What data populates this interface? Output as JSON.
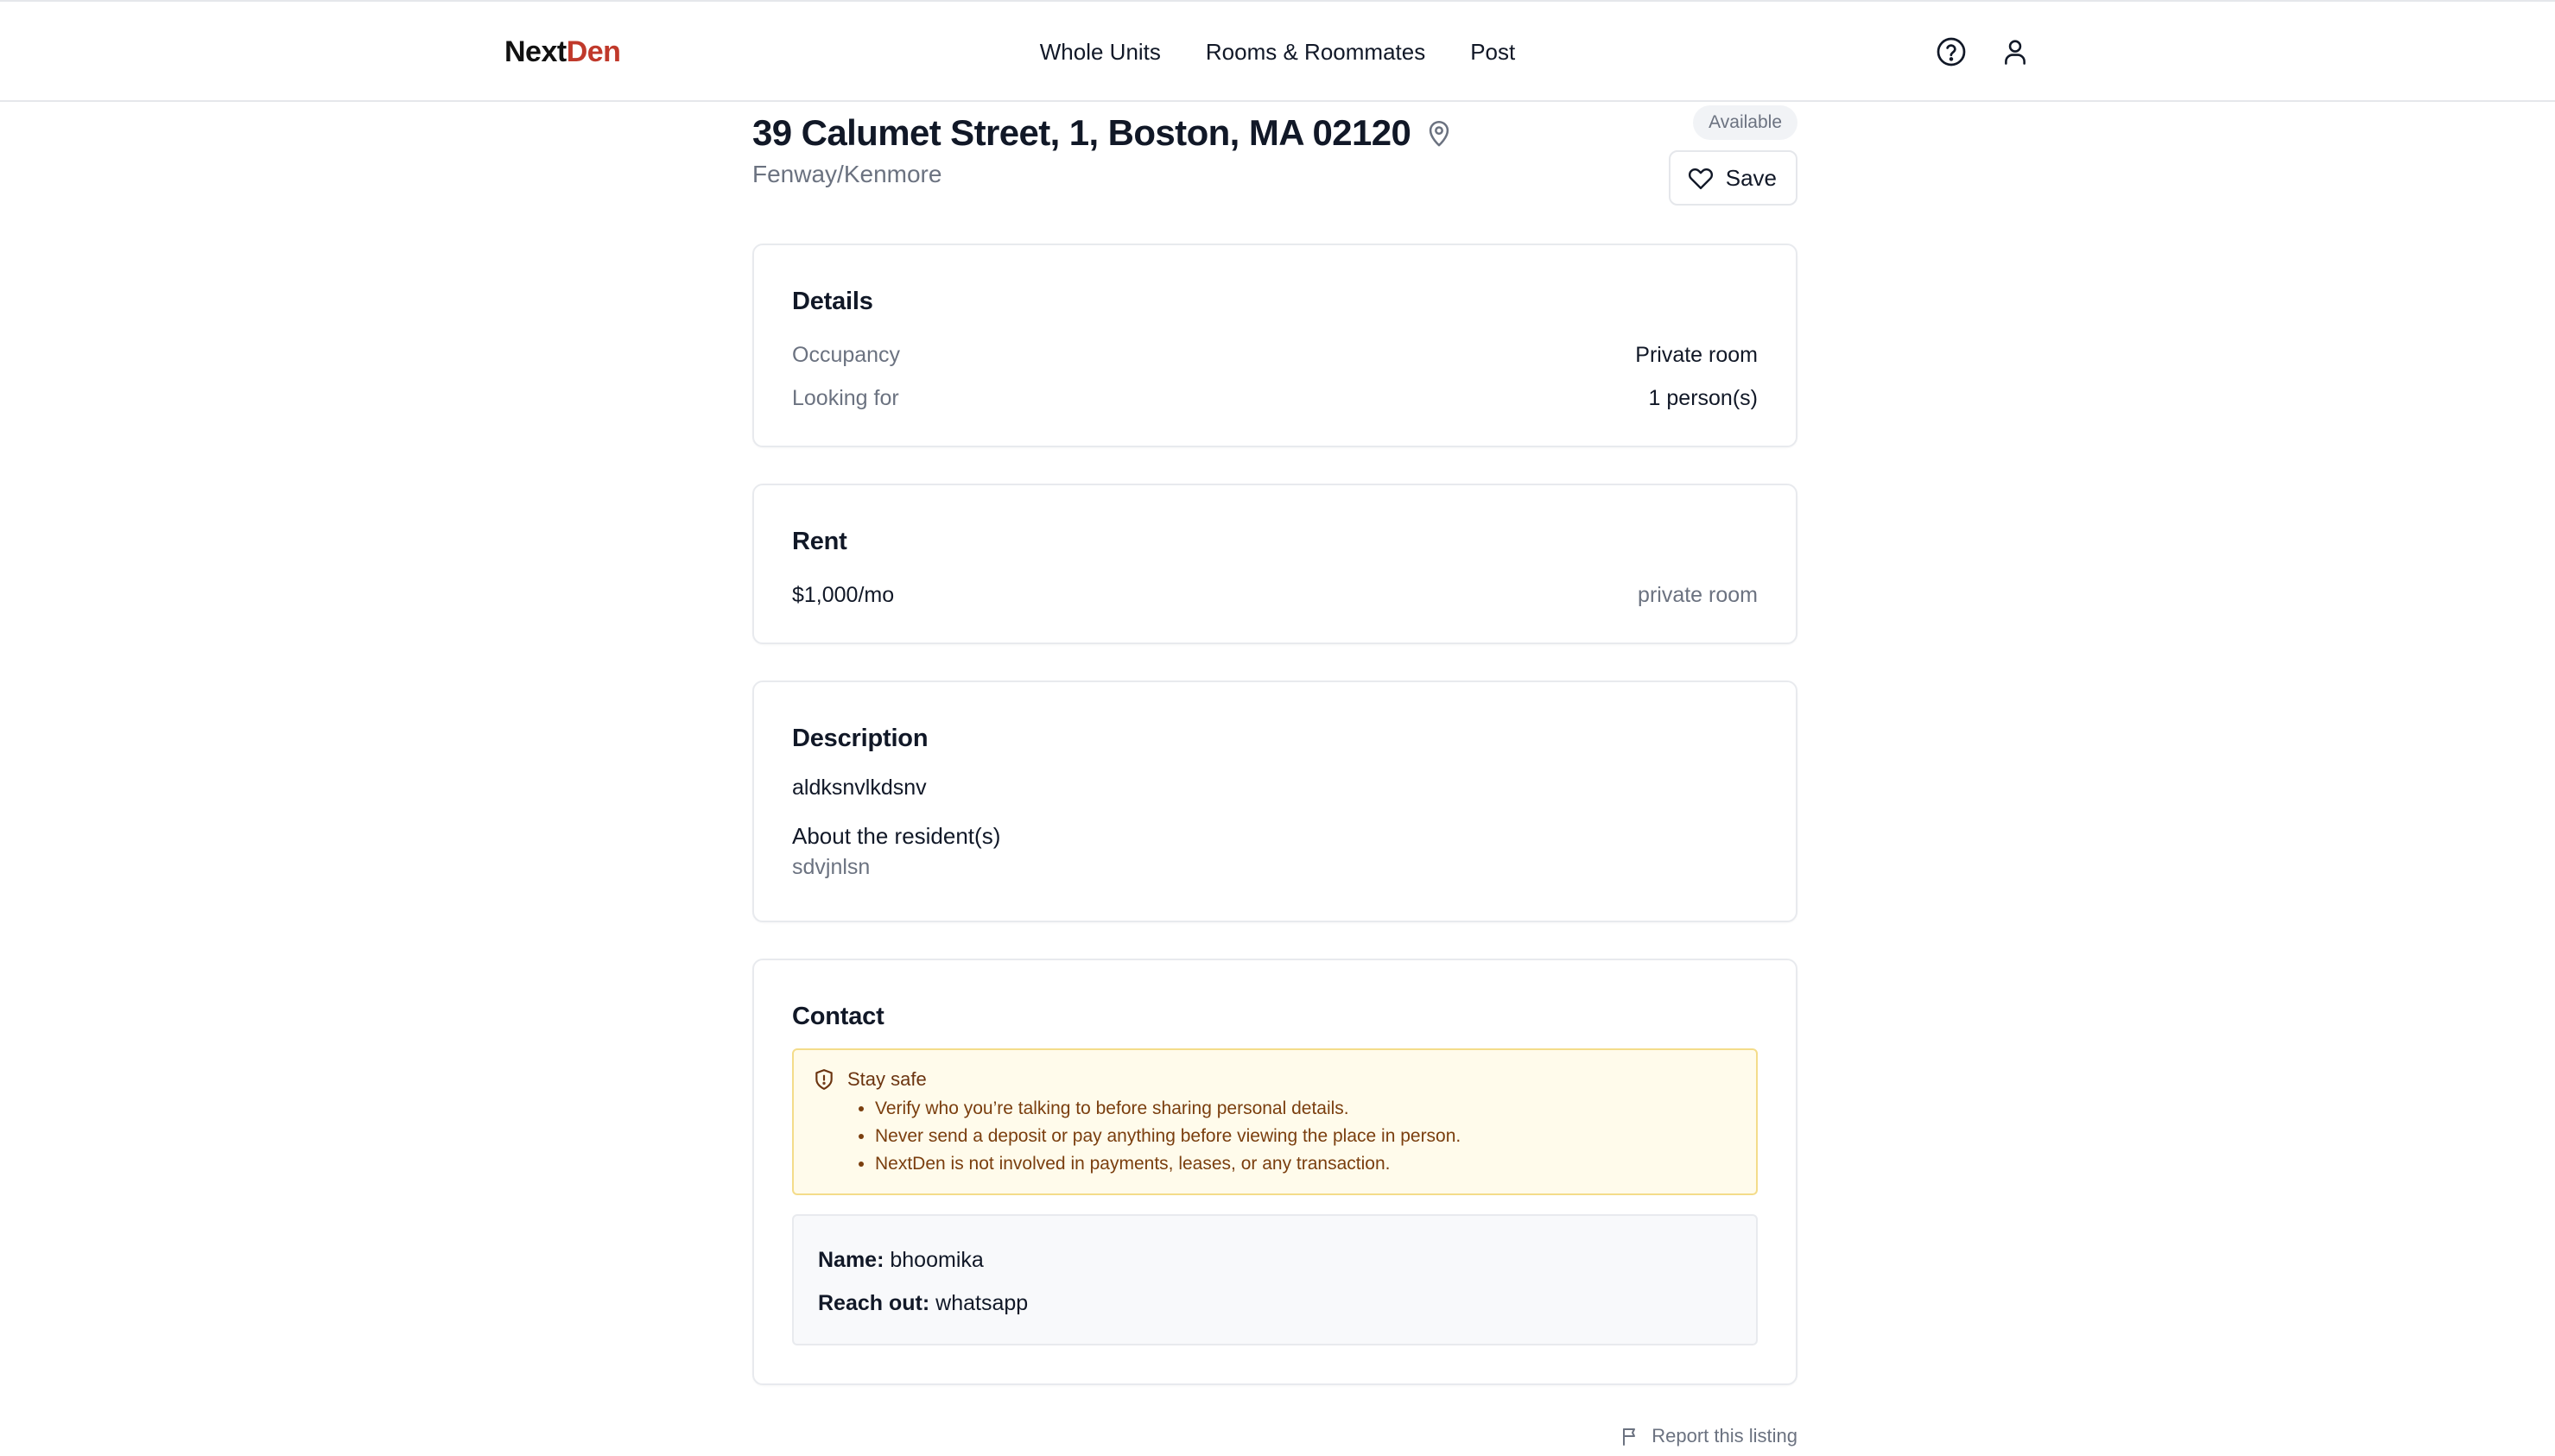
{
  "header": {
    "logo_part1": "Next",
    "logo_part2": "Den",
    "nav": [
      "Whole Units",
      "Rooms & Roommates",
      "Post"
    ],
    "icons": [
      "help-icon",
      "user-icon"
    ]
  },
  "listing": {
    "title": "39 Calumet Street, 1, Boston, MA 02120",
    "neighborhood": "Fenway/Kenmore",
    "status": "Available",
    "save_label": "Save"
  },
  "details": {
    "heading": "Details",
    "rows": [
      {
        "label": "Occupancy",
        "value": "Private room"
      },
      {
        "label": "Looking for",
        "value": "1 person(s)"
      }
    ]
  },
  "rent": {
    "heading": "Rent",
    "price": "$1,000/mo",
    "type": "private room"
  },
  "description": {
    "heading": "Description",
    "text": "aldksnvlkdsnv",
    "about_label": "About the resident(s)",
    "about_text": "sdvjnlsn"
  },
  "contact": {
    "heading": "Contact",
    "safety_title": "Stay safe",
    "safety_items": [
      "Verify who you’re talking to before sharing personal details.",
      "Never send a deposit or pay anything before viewing the place in person.",
      "NextDen is not involved in payments, leases, or any transaction."
    ],
    "name_label": "Name:",
    "name_value": "bhoomika",
    "reach_label": "Reach out:",
    "reach_value": "whatsapp"
  },
  "report_label": "Report this listing",
  "colors": {
    "brand_red": "#c0392b",
    "warning_bg": "#fffbeb",
    "warning_border": "#f4dc8a"
  }
}
